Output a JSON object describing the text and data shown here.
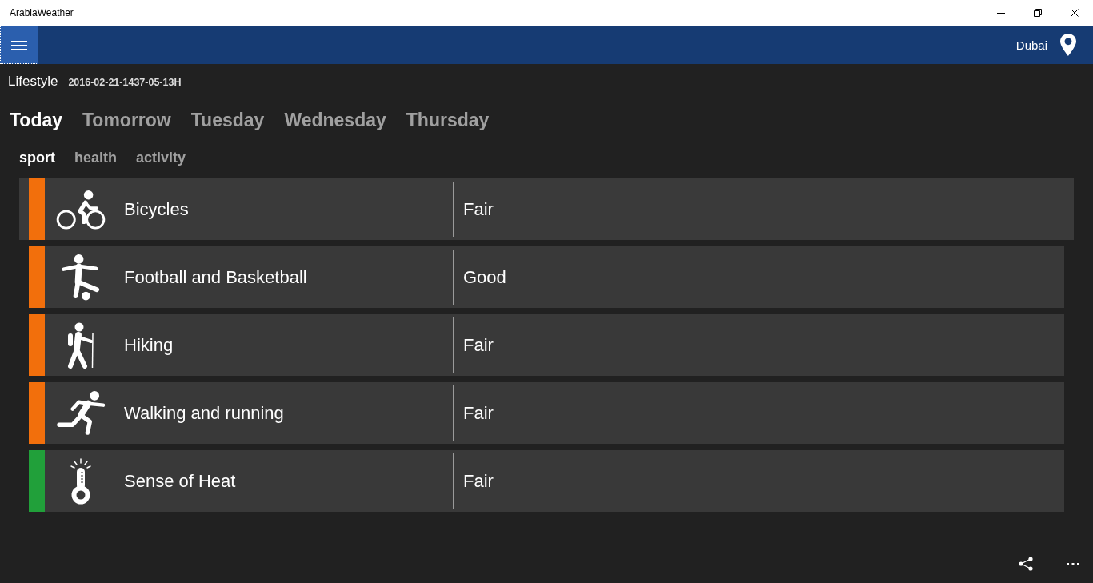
{
  "window": {
    "title": "ArabiaWeather"
  },
  "header": {
    "location": "Dubai"
  },
  "page": {
    "title": "Lifestyle",
    "date": "2016-02-21-1437-05-13H"
  },
  "day_tabs": [
    {
      "label": "Today",
      "selected": true
    },
    {
      "label": "Tomorrow",
      "selected": false
    },
    {
      "label": "Tuesday",
      "selected": false
    },
    {
      "label": "Wednesday",
      "selected": false
    },
    {
      "label": "Thursday",
      "selected": false
    }
  ],
  "category_tabs": [
    {
      "label": "sport",
      "selected": true
    },
    {
      "label": "health",
      "selected": false
    },
    {
      "label": "activity",
      "selected": false
    }
  ],
  "rows": [
    {
      "kind": "bicycle",
      "name": "Bicycles",
      "rating": "Fair",
      "color": "#f26f0c",
      "selected": true
    },
    {
      "kind": "football",
      "name": "Football and Basketball",
      "rating": "Good",
      "color": "#f26f0c",
      "selected": false
    },
    {
      "kind": "hiking",
      "name": "Hiking",
      "rating": "Fair",
      "color": "#f26f0c",
      "selected": false
    },
    {
      "kind": "running",
      "name": "Walking and running",
      "rating": "Fair",
      "color": "#f26f0c",
      "selected": false
    },
    {
      "kind": "heat",
      "name": "Sense of Heat",
      "rating": "Fair",
      "color": "#21a03a",
      "selected": false
    }
  ]
}
